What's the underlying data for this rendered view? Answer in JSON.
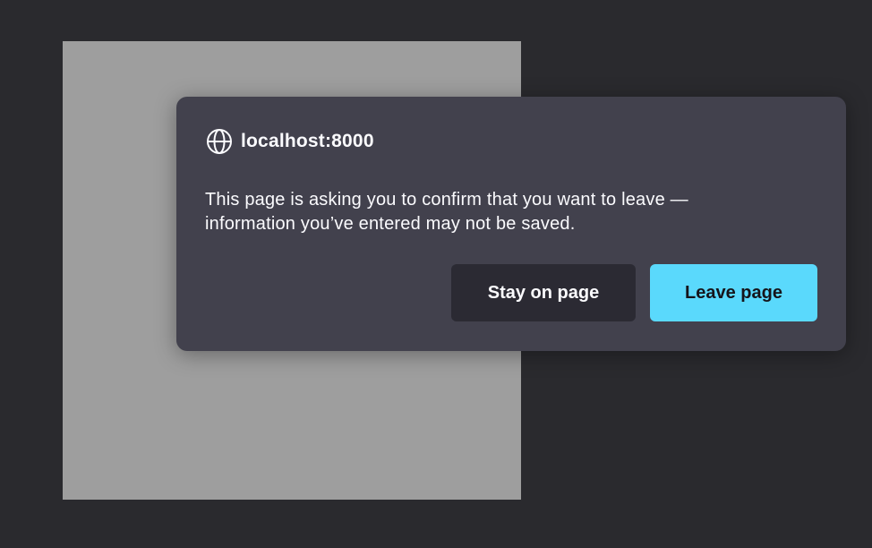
{
  "dialog": {
    "icon": "globe-icon",
    "origin": "localhost:8000",
    "message_line1": "This page is asking you to confirm that you want to leave —",
    "message_line2": "information you’ve entered may not be saved.",
    "stay_label": "Stay on page",
    "leave_label": "Leave page"
  },
  "colors": {
    "background": "#2a2a2e",
    "page_placeholder": "#9e9e9e",
    "dialog_bg": "#42414d",
    "secondary_button": "#2b2a33",
    "primary_button": "#5ad9fc"
  }
}
